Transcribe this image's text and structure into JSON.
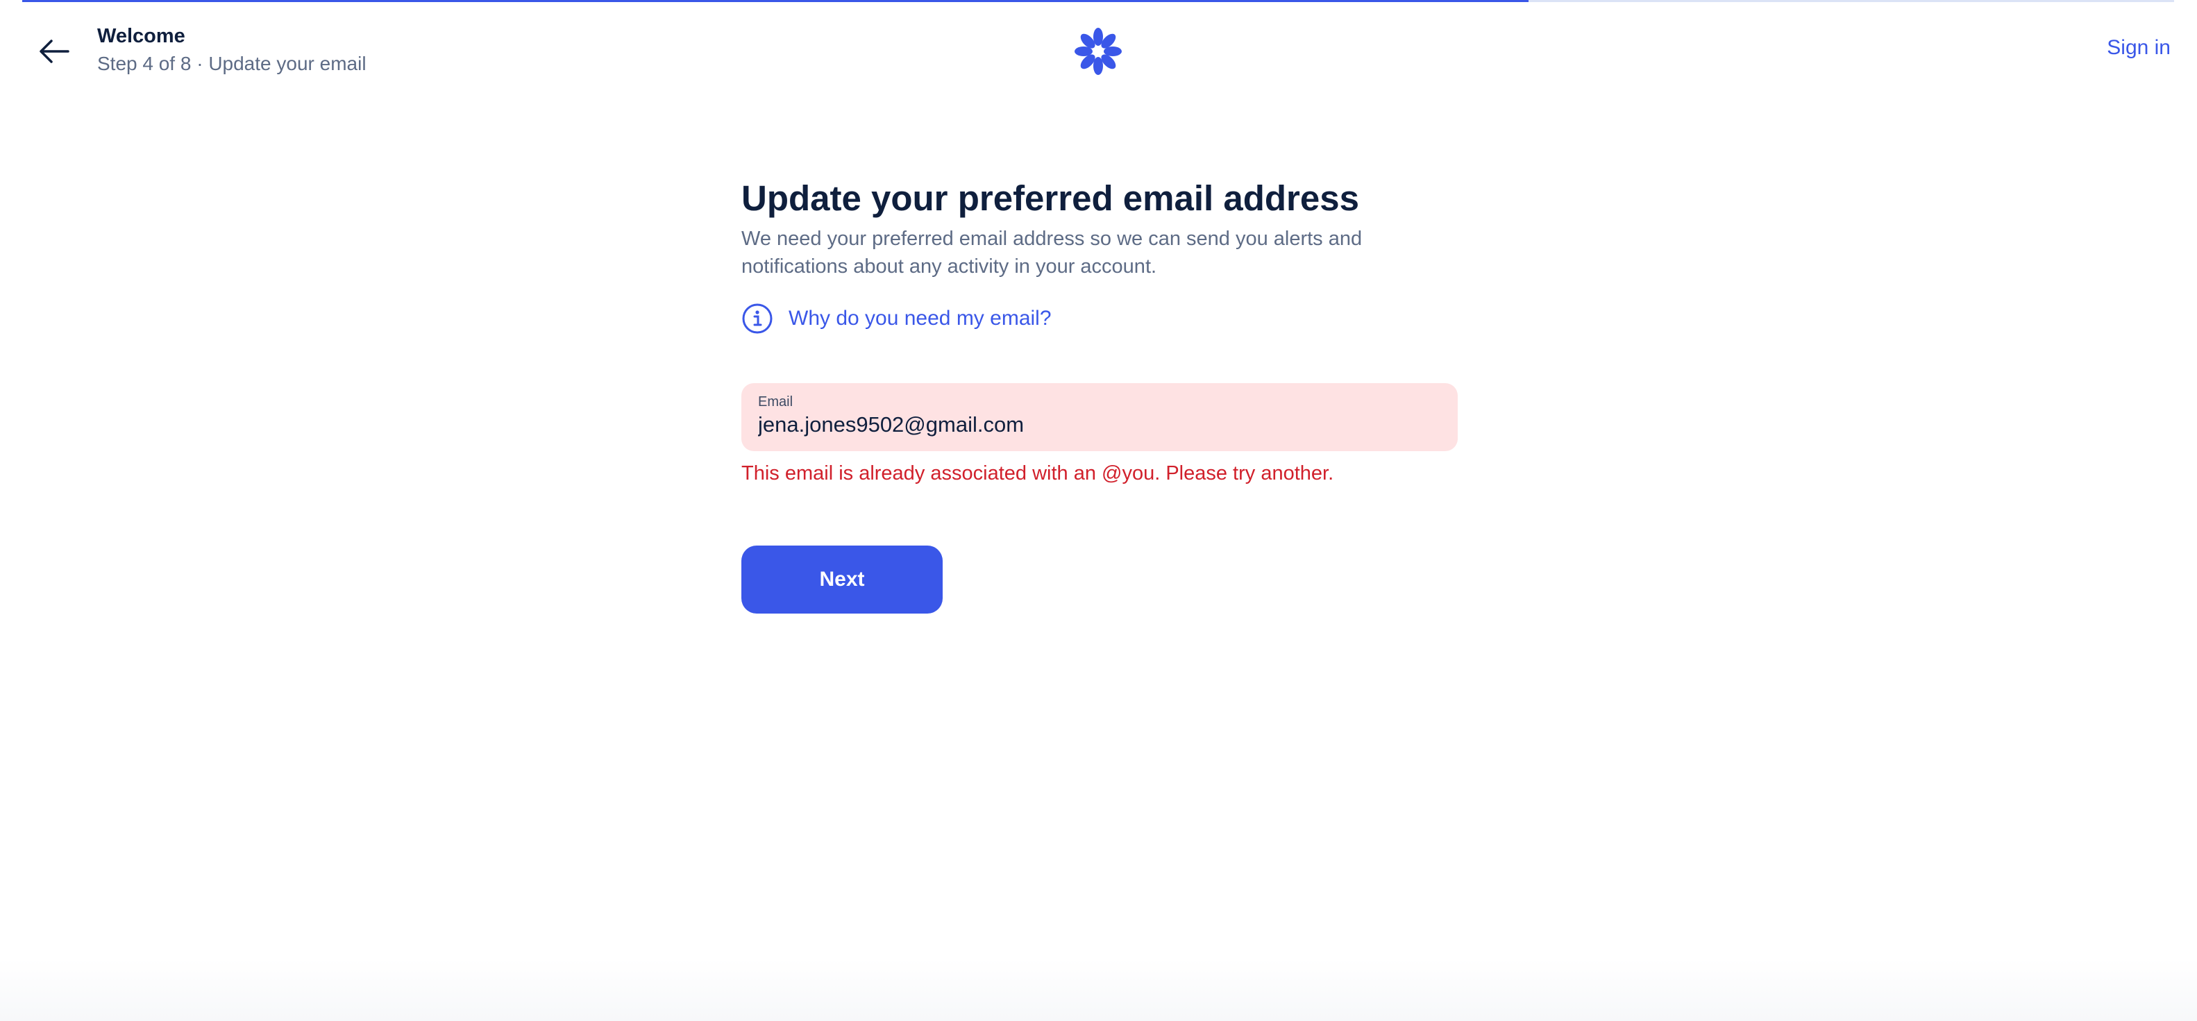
{
  "progress": {
    "step": 4,
    "total": 8,
    "fraction": 0.7
  },
  "header": {
    "title": "Welcome",
    "subtitle": "Step 4 of 8 · Update your email",
    "sign_in_label": "Sign in"
  },
  "main": {
    "title": "Update your preferred email address",
    "description": "We need your preferred email address so we can send you alerts and notifications about any activity in your account.",
    "why_link_label": "Why do you need my email?"
  },
  "email_field": {
    "label": "Email",
    "value": "jena.jones9502@gmail.com",
    "error": "This email is already associated with an @you. Please try another."
  },
  "next_button_label": "Next",
  "colors": {
    "accent": "#3a57e8",
    "error": "#d1202b",
    "error_bg": "#fee2e3",
    "text_primary": "#0f1f3d",
    "text_secondary": "#5d6b85"
  },
  "icons": [
    "arrow-left-icon",
    "flower-logo-icon",
    "info-icon"
  ]
}
